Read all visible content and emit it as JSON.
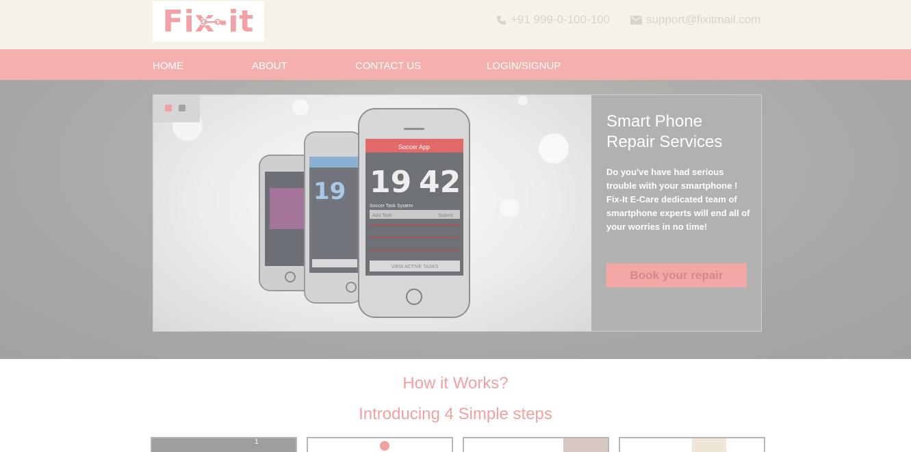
{
  "brand": {
    "logo_text": "Fix-it"
  },
  "contact": {
    "phone": "+91 999-0-100-100",
    "email": "support@fixitmail.com"
  },
  "nav": {
    "items": [
      {
        "label": "HOME",
        "active": true
      },
      {
        "label": "ABOUT"
      },
      {
        "label": "CONTACT US"
      },
      {
        "label": "LOGIN/SIGNUP"
      }
    ]
  },
  "hero": {
    "slide_count": 2,
    "active_slide": 1,
    "title": "Smart Phone\nRepair Services",
    "description": "Do you've have had serious trouble with your smartphone !\nFix-It E-Care dedicated team of smartphone experts will end all of your worries in no time!",
    "cta_label": "Book your repair",
    "phone_screen": {
      "app_title": "Soccer App",
      "time_hours": "19",
      "time_minutes": "42",
      "section": "Soccer Task System",
      "input_placeholder": "Add Task",
      "submit_label": "Submit",
      "button_label": "VIEW ACTIVE TASKS"
    }
  },
  "how": {
    "title": "How it Works?",
    "subtitle": "Introducing 4 Simple steps"
  },
  "colors": {
    "accent": "#f5b0ad",
    "topbar": "#f5f2ea",
    "heading": "#f2a1a1"
  }
}
